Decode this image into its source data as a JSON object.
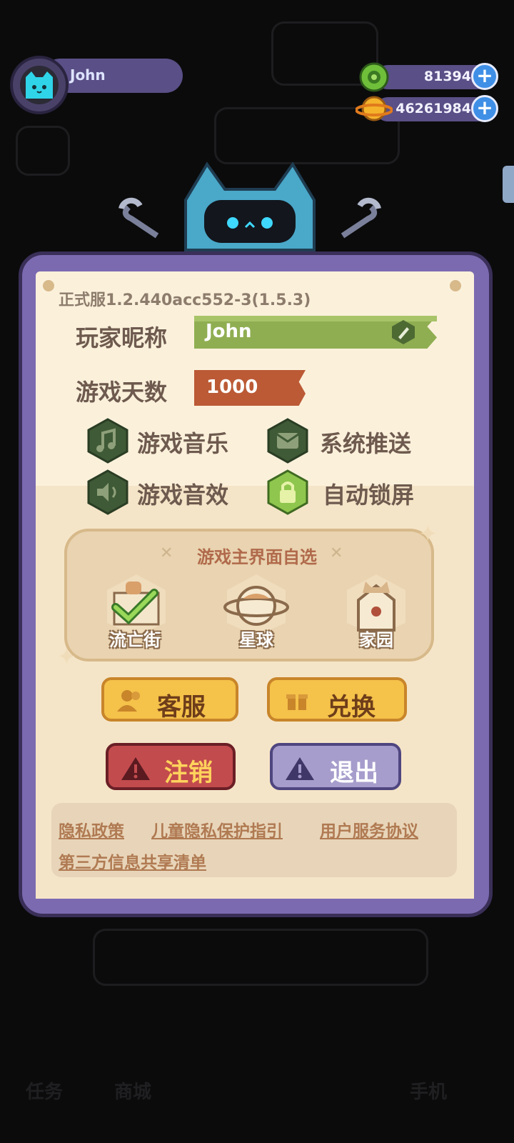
{
  "player": {
    "name": "John"
  },
  "currency": {
    "green_coins": "81394",
    "gold_planets": "46261984"
  },
  "settings": {
    "version": "正式服1.2.440acc552-3(1.5.3)",
    "nickname_label": "玩家昵称",
    "nickname_value": "John",
    "days_label": "游戏天数",
    "days_value": "1000",
    "toggles": [
      {
        "label": "游戏音乐",
        "icon": "music-note-icon",
        "on": false
      },
      {
        "label": "系统推送",
        "icon": "mail-icon",
        "on": false
      },
      {
        "label": "游戏音效",
        "icon": "speaker-icon",
        "on": false
      },
      {
        "label": "自动锁屏",
        "icon": "lock-icon",
        "on": true
      }
    ]
  },
  "home_select": {
    "title": "游戏主界面自选",
    "options": [
      {
        "label": "流亡街",
        "icon": "street-icon",
        "selected": true
      },
      {
        "label": "星球",
        "icon": "planet-icon",
        "selected": false
      },
      {
        "label": "家园",
        "icon": "house-icon",
        "selected": false
      }
    ]
  },
  "buttons": {
    "support": "客服",
    "redeem": "兑换",
    "deregister": "注销",
    "logout": "退出"
  },
  "links": [
    "隐私政策",
    "儿童隐私保护指引",
    "用户服务协议",
    "第三方信息共享清单"
  ],
  "background_nav": [
    "任务",
    "商城",
    "手机"
  ],
  "colors": {
    "panel_border": "#7b6ab0",
    "paper": "#fbf1db",
    "nickname_banner": "#8fae52",
    "days_banner": "#bb5a35",
    "toggle_off": "#3f5a36",
    "toggle_on": "#8fc64d"
  }
}
